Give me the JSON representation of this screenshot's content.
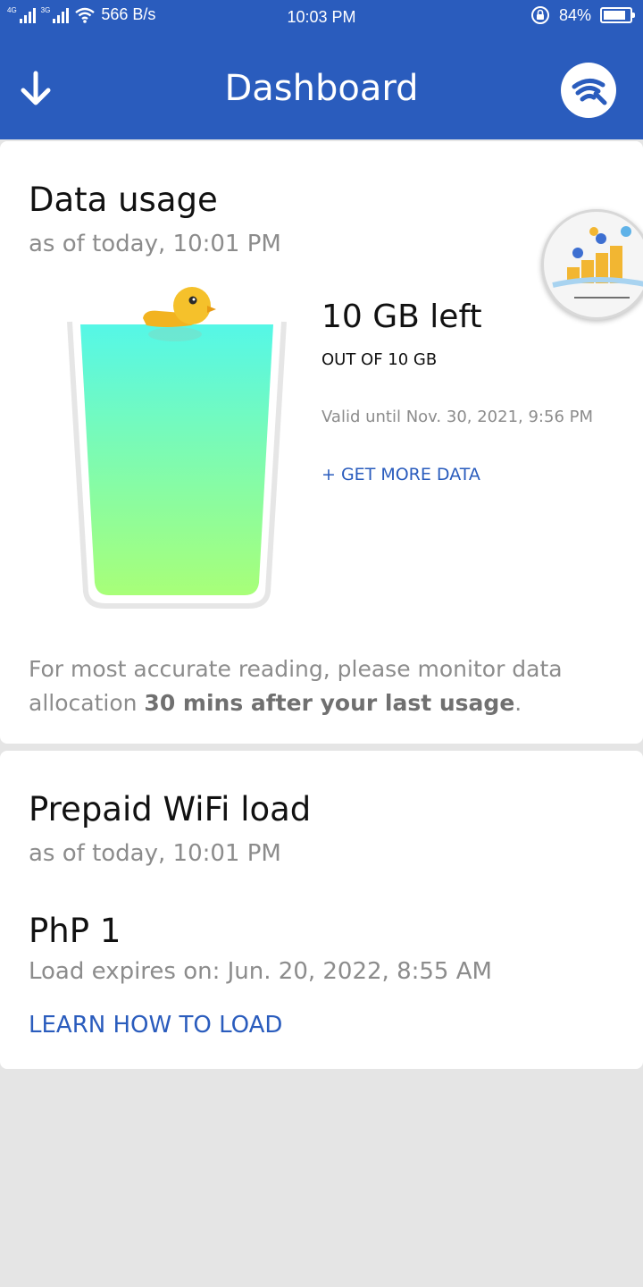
{
  "status_bar": {
    "network_tag_1": "4G",
    "network_tag_2": "3G",
    "speed": "566 B/s",
    "time": "10:03 PM",
    "battery": "84%",
    "battery_level": 0.84
  },
  "header": {
    "title": "Dashboard",
    "download_icon": "arrow-down-icon",
    "wifi_icon": "wifi-logo-icon"
  },
  "data_usage": {
    "title": "Data usage",
    "as_of": "as of today, 10:01 PM",
    "remaining": "10 GB left",
    "out_of": "OUT OF 10 GB",
    "valid_until": "Valid until Nov. 30, 2021, 9:56 PM",
    "get_more": "+ GET MORE DATA",
    "fill_level": 1.0,
    "note_prefix": "For most accurate reading, please monitor data allocation ",
    "note_bold": "30 mins after your last usage",
    "note_suffix": "."
  },
  "prepaid": {
    "title": "Prepaid WiFi load",
    "as_of": "as of today, 10:01 PM",
    "amount": "PhP 1",
    "expires": "Load expires on: Jun. 20, 2022, 8:55 AM",
    "learn_link": "LEARN HOW TO LOAD"
  },
  "colors": {
    "brand_blue": "#2a5cbd",
    "glass_top": "#55f7e7",
    "glass_bottom": "#a8ff78",
    "duck": "#f5c12b"
  }
}
